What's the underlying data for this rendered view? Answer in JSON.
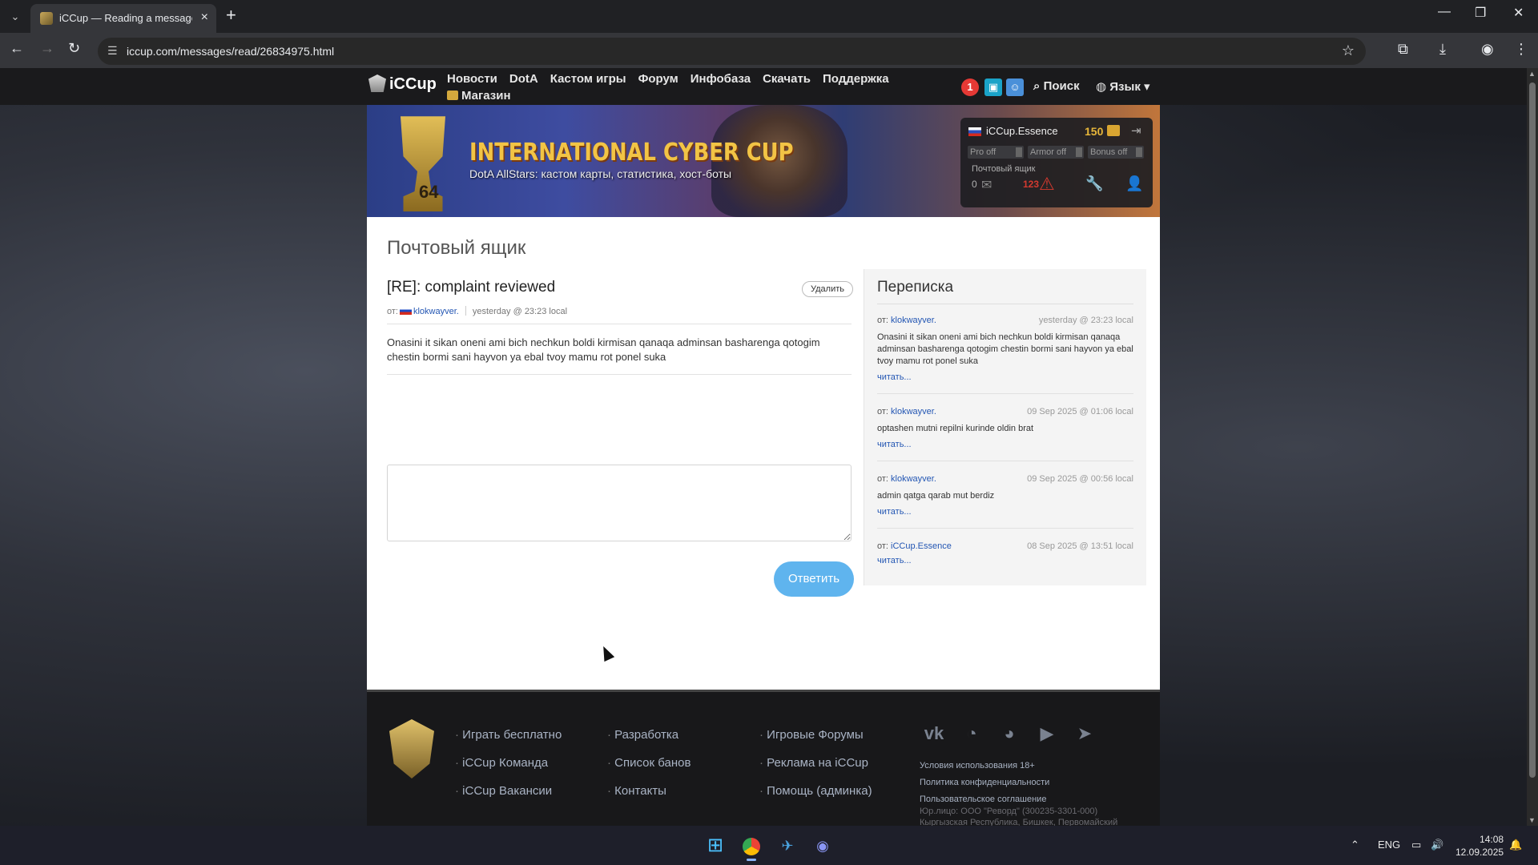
{
  "browser": {
    "tab_title": "iCCup — Reading a message fr",
    "url": "iccup.com/messages/read/26834975.html"
  },
  "nav": {
    "logo": "iCCup",
    "links": [
      "Новости",
      "DotA",
      "Кастом игры",
      "Форум",
      "Инфобаза",
      "Скачать",
      "Поддержка",
      "Магазин"
    ],
    "notif_count": "1",
    "search": "Поиск",
    "lang": "Язык"
  },
  "banner": {
    "title": "INTERNATIONAL CYBER CUP",
    "subtitle": "DotA AllStars: кастом карты, статистика, хост-боты",
    "badge": "64"
  },
  "userbox": {
    "username": "iCCup.Essence",
    "coins": "150",
    "toggles": [
      "Pro off",
      "Armor off",
      "Bonus off"
    ],
    "mailbox_label": "Почтовый ящик",
    "mail_count": "0",
    "warn_count": "123"
  },
  "page": {
    "title": "Почтовый ящик"
  },
  "message": {
    "subject": "[RE]: complaint reviewed",
    "delete_label": "Удалить",
    "from_prefix": "от:",
    "author": "klokwayver.",
    "date": "yesterday @ 23:23 local",
    "body": "Onasini it sikan oneni ami bich nechkun boldi kirmisan qanaqa adminsan basharenga qotogim chestin bormi sani hayvon ya ebal tvoy mamu rot ponel suka",
    "reply_value": "",
    "reply_button": "Ответить"
  },
  "correspondence": {
    "title": "Переписка",
    "items": [
      {
        "from_prefix": "от:",
        "from": "klokwayver.",
        "date": "yesterday @ 23:23 local",
        "text": "Onasini it sikan oneni ami bich nechkun boldi kirmisan qanaqa adminsan basharenga qotogim chestin bormi sani hayvon ya ebal tvoy mamu rot ponel suka",
        "read": "читать..."
      },
      {
        "from_prefix": "от:",
        "from": "klokwayver.",
        "date": "09 Sep 2025 @ 01:06 local",
        "text": "optashen mutni repilni kurinde oldin brat",
        "read": "читать..."
      },
      {
        "from_prefix": "от:",
        "from": "klokwayver.",
        "date": "09 Sep 2025 @ 00:56 local",
        "text": "admin qatga qarab mut berdiz",
        "read": "читать..."
      },
      {
        "from_prefix": "от:",
        "from": "iCCup.Essence",
        "date": "08 Sep 2025 @ 13:51 local",
        "text": "",
        "read": "читать..."
      }
    ]
  },
  "footer": {
    "col1": [
      "Играть бесплатно",
      "iCCup Команда",
      "iCCup Вакансии"
    ],
    "col2": [
      "Разработка",
      "Список банов",
      "Контакты"
    ],
    "col3": [
      "Игровые Форумы",
      "Реклама на iCCup",
      "Помощь (админка)"
    ],
    "links": [
      "Условия использования 18+",
      "Политика конфиденциальности",
      "Пользовательское соглашение"
    ],
    "legal_1": "Юр.лицо: ООО \"Реворд\" (300235-3301-000)",
    "legal_2": "Кыргызская Республика, Бишкек, Первомайский"
  },
  "taskbar": {
    "lang": "ENG",
    "time": "14:08",
    "date": "12.09.2025"
  }
}
